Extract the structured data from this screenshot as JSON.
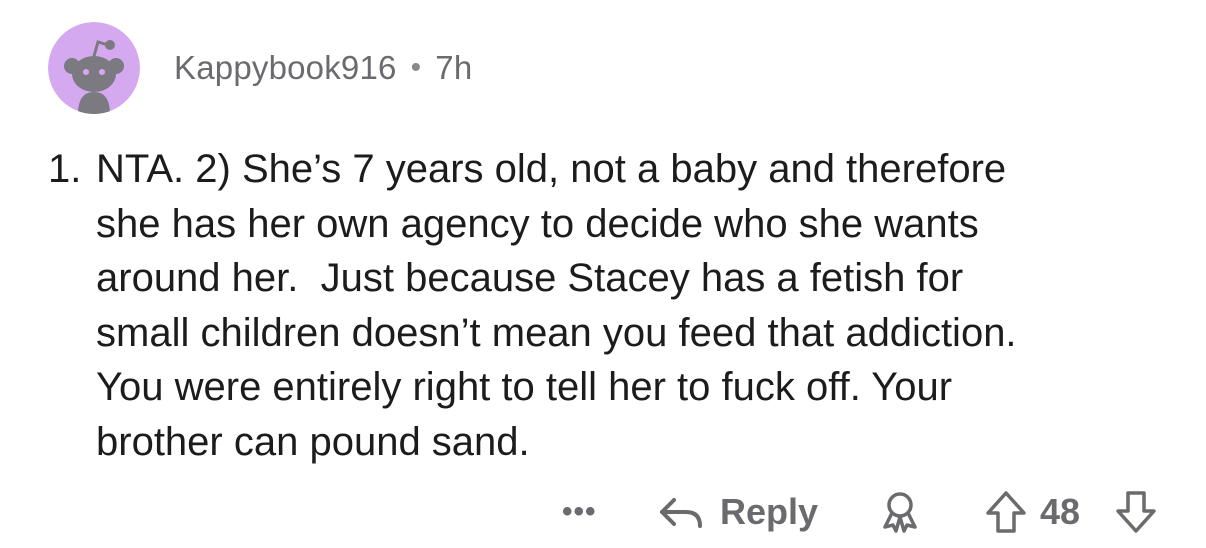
{
  "comment": {
    "username": "Kappybook916",
    "separator": "•",
    "age": "7h",
    "number_prefix": "1.",
    "text": "NTA. 2) She’s 7 years old, not a baby and therefore\nshe has her own agency to decide who she wants\naround her.  Just because Stacey has a fetish for\nsmall children doesn’t mean you feed that addiction.\nYou were entirely right to tell her to fuck off. Your\nbrother can pound sand.",
    "avatar_icon": "snoo-avatar-icon"
  },
  "actions": {
    "more_label": "•••",
    "reply_label": "Reply",
    "score": "48",
    "reply_icon": "reply-arrow-icon",
    "award_icon": "award-icon",
    "upvote_icon": "upvote-arrow-icon",
    "downvote_icon": "downvote-arrow-icon"
  },
  "colors": {
    "avatar_bg": "#d4a9f0",
    "text": "#1c1c1e",
    "muted": "#6b6b6f"
  }
}
